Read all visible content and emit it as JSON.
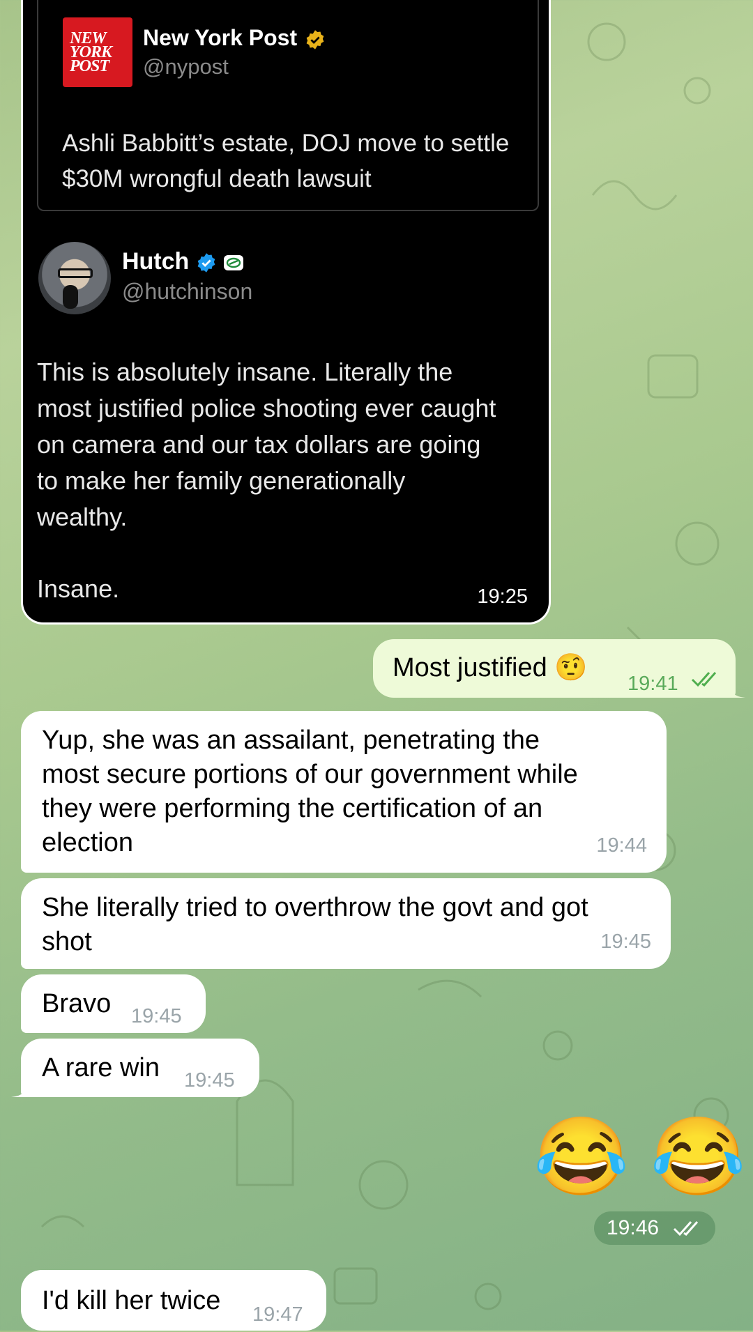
{
  "screenshot": {
    "source": {
      "name": "New York Post",
      "handle": "@nypost",
      "logo_text": "NEW YORK POST",
      "text": "Ashli Babbitt’s estate, DOJ move to settle\n$30M wrongful death lawsuit"
    },
    "reply": {
      "name": "Hutch",
      "handle": "@hutchinson",
      "text": "This is absolutely insane. Literally the\nmost justified police shooting ever caught\non camera and our tax dollars are going\nto make her family generationally\nwealthy.",
      "text2": "Insane."
    },
    "time": "19:25"
  },
  "messages": [
    {
      "id": "m1",
      "text": "Most justified 🤨",
      "time": "19:41",
      "outgoing": true
    },
    {
      "id": "m2",
      "text": "Yup, she was an assailant, penetrating the\nmost secure portions of our government while\nthey were performing the certification of an\nelection",
      "time": "19:44",
      "outgoing": false
    },
    {
      "id": "m3",
      "text": "She literally tried to overthrow the govt and got\nshot",
      "time": "19:45",
      "outgoing": false
    },
    {
      "id": "m4",
      "text": "Bravo",
      "time": "19:45",
      "outgoing": false
    },
    {
      "id": "m5",
      "text": "A rare win",
      "time": "19:45",
      "outgoing": false
    },
    {
      "id": "m6",
      "text": "😂 😂",
      "time": "19:46",
      "outgoing": true
    },
    {
      "id": "m7",
      "text": "I'd kill her twice",
      "time": "19:47",
      "outgoing": false
    }
  ],
  "colors": {
    "check": "#4fae4e",
    "verified_gold": "#e8b21a",
    "verified_blue": "#1d9bf0",
    "np_red": "#d71920"
  }
}
